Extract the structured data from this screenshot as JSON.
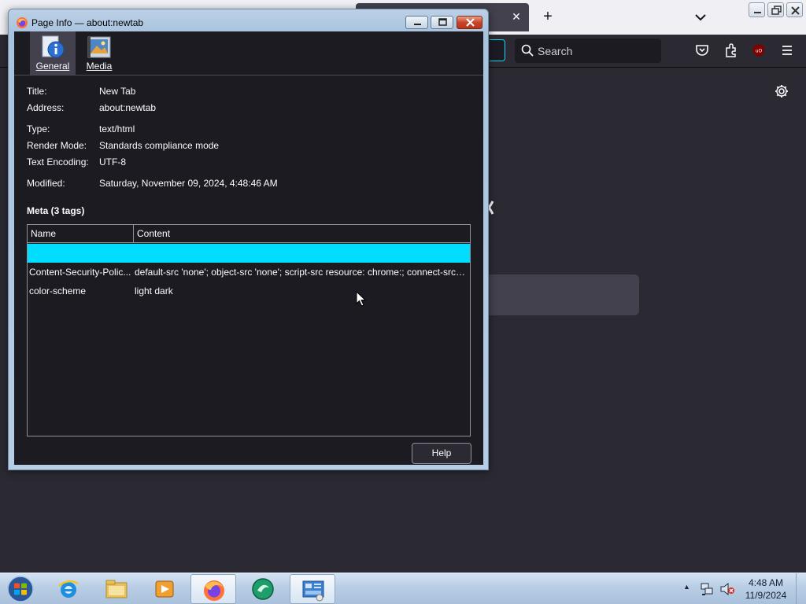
{
  "browser": {
    "search_placeholder": "Search",
    "tab_close_glyph": "✕",
    "new_tab_glyph": "+"
  },
  "dialog": {
    "title": "Page Info — about:newtab",
    "panes": [
      {
        "label": "General",
        "icon": "info-icon",
        "selected": true
      },
      {
        "label": "Media",
        "icon": "media-icon",
        "selected": false
      }
    ],
    "fields": {
      "title": {
        "label": "Title:",
        "value": "New Tab"
      },
      "address": {
        "label": "Address:",
        "value": "about:newtab"
      },
      "type": {
        "label": "Type:",
        "value": "text/html"
      },
      "render_mode": {
        "label": "Render Mode:",
        "value": "Standards compliance mode"
      },
      "encoding": {
        "label": "Text Encoding:",
        "value": "UTF-8"
      },
      "modified": {
        "label": "Modified:",
        "value": "Saturday, November 09, 2024, 4:48:46 AM"
      }
    },
    "meta_heading": "Meta (3 tags)",
    "meta_table": {
      "columns": [
        "Name",
        "Content"
      ],
      "rows": [
        {
          "name": "",
          "content": "",
          "selected": true
        },
        {
          "name": "Content-Security-Polic...",
          "content": "default-src 'none'; object-src 'none'; script-src resource: chrome:; connect-src ...",
          "selected": false
        },
        {
          "name": "color-scheme",
          "content": "light dark",
          "selected": false
        }
      ]
    },
    "help_label": "Help"
  },
  "taskbar": {
    "apps": [
      {
        "name": "internet-explorer",
        "active": false
      },
      {
        "name": "windows-explorer",
        "active": false
      },
      {
        "name": "media-player",
        "active": false
      },
      {
        "name": "firefox",
        "active": true
      },
      {
        "name": "green-app",
        "active": false
      },
      {
        "name": "control-panel",
        "active": true
      }
    ],
    "clock_time": "4:48 AM",
    "clock_date": "11/9/2024"
  },
  "colors": {
    "accent": "#00ddff",
    "dialog_bg": "#1c1b22",
    "taskbar_bg": "#b9cee5"
  }
}
